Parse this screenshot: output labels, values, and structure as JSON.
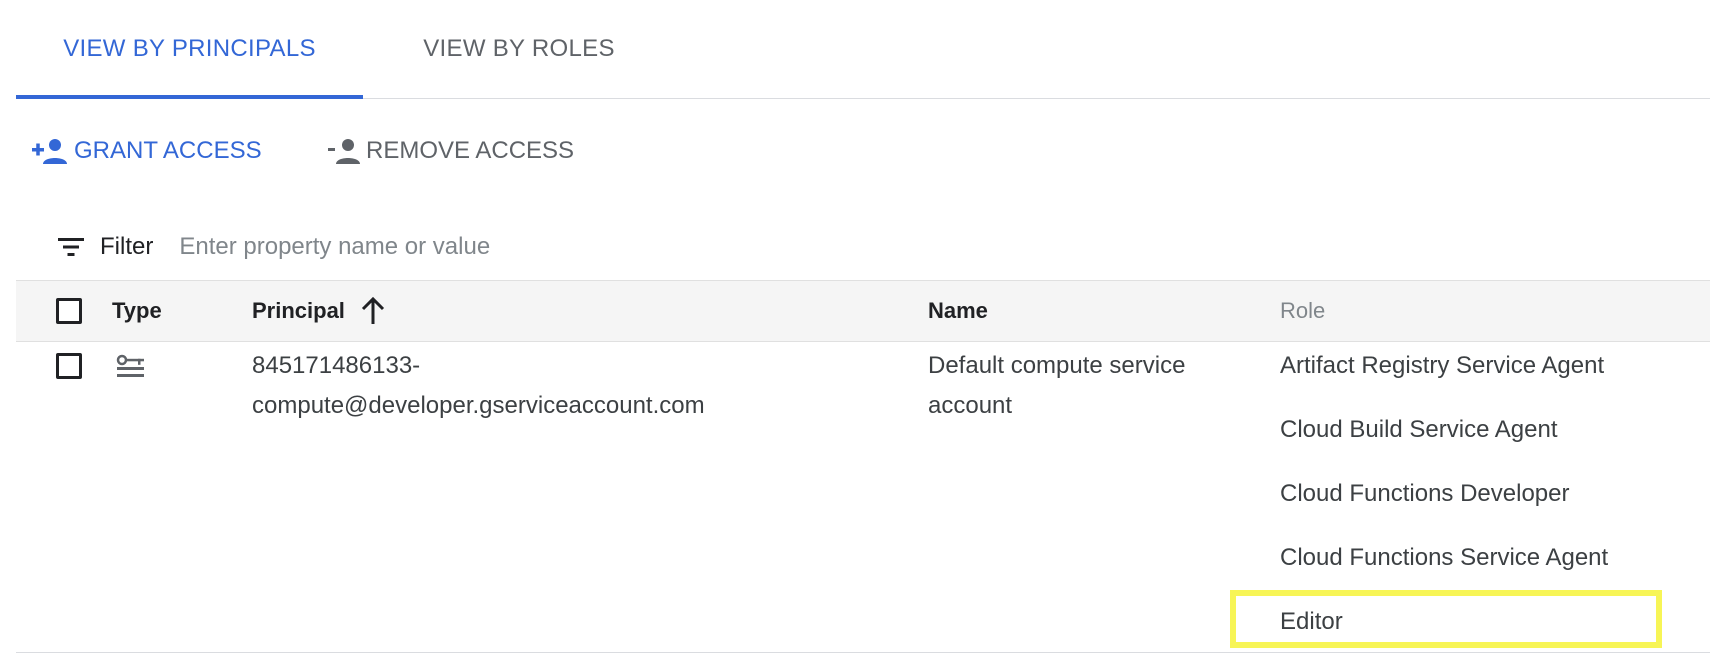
{
  "tabs": [
    {
      "label": "VIEW BY PRINCIPALS",
      "active": true
    },
    {
      "label": "VIEW BY ROLES",
      "active": false
    }
  ],
  "actions": {
    "grant_label": "GRANT ACCESS",
    "remove_label": "REMOVE ACCESS"
  },
  "filter": {
    "label": "Filter",
    "placeholder": "Enter property name or value"
  },
  "table": {
    "headers": {
      "type": "Type",
      "principal": "Principal",
      "name": "Name",
      "role": "Role"
    },
    "rows": [
      {
        "type_icon": "service-account-icon",
        "principal_line1": "845171486133-",
        "principal_line2": "compute@developer.gserviceaccount.com",
        "name_line1": "Default compute service",
        "name_line2": "account",
        "roles": [
          "Artifact Registry Service Agent",
          "Cloud Build Service Agent",
          "Cloud Functions Developer",
          "Cloud Functions Service Agent",
          "Editor"
        ]
      }
    ]
  },
  "colors": {
    "accent": "#3367d6",
    "highlight": "#f7f556"
  }
}
